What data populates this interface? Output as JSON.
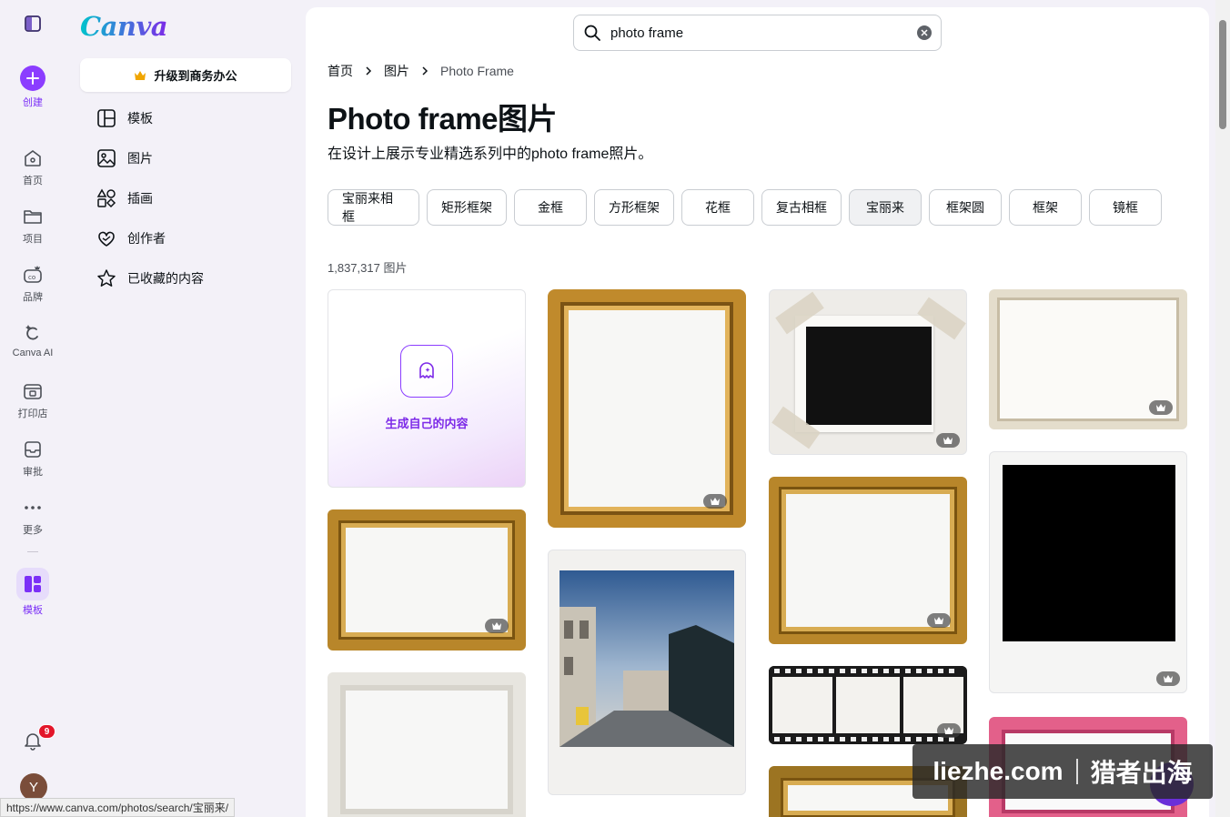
{
  "rail": {
    "create_label": "创建",
    "items": [
      {
        "label": "首页"
      },
      {
        "label": "项目"
      },
      {
        "label": "品牌"
      },
      {
        "label": "Canva AI"
      },
      {
        "label": "打印店"
      },
      {
        "label": "审批"
      },
      {
        "label": "更多"
      },
      {
        "label": "模板"
      }
    ],
    "notification_count": "9",
    "avatar_initial": "Y"
  },
  "panel": {
    "logo": "Canva",
    "upgrade_label": "升级到商务办公",
    "nav": [
      {
        "label": "模板",
        "icon": "template-icon"
      },
      {
        "label": "图片",
        "icon": "image-icon"
      },
      {
        "label": "插画",
        "icon": "shapes-icon"
      },
      {
        "label": "创作者",
        "icon": "heart-icon"
      },
      {
        "label": "已收藏的内容",
        "icon": "star-icon"
      }
    ]
  },
  "search": {
    "value": "photo frame"
  },
  "breadcrumb": {
    "home": "首页",
    "images": "图片",
    "current": "Photo Frame"
  },
  "page": {
    "title": "Photo frame图片",
    "description": "在设计上展示专业精选系列中的photo frame照片。",
    "result_count": "1,837,317 图片"
  },
  "chips": [
    "宝丽来相框",
    "矩形框架",
    "金框",
    "方形框架",
    "花框",
    "复古相框",
    "宝丽来",
    "框架圆",
    "框架",
    "镜框"
  ],
  "generate_label": "生成自己的内容",
  "watermark": {
    "left": "liezhe.com",
    "right": "猎者出海"
  },
  "status_url": "https://www.canva.com/photos/search/宝丽来/",
  "colors": {
    "accent": "#8b3dff",
    "badge": "#e3162a"
  }
}
